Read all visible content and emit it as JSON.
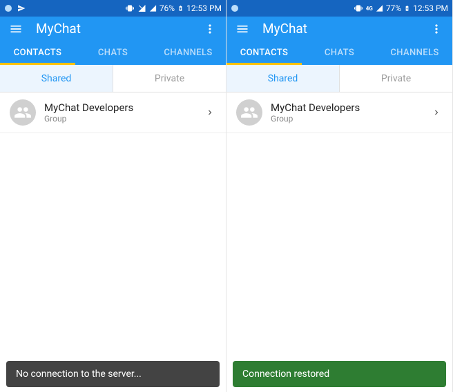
{
  "screens": [
    {
      "statusbar": {
        "battery": "76%",
        "time": "12:53 PM",
        "network": "no-data"
      },
      "appbar": {
        "title": "MyChat"
      },
      "topTabs": [
        {
          "label": "CONTACTS",
          "active": true
        },
        {
          "label": "CHATS",
          "active": false
        },
        {
          "label": "CHANNELS",
          "active": false
        }
      ],
      "subTabs": [
        {
          "label": "Shared",
          "active": true
        },
        {
          "label": "Private",
          "active": false
        }
      ],
      "contacts": [
        {
          "title": "MyChat Developers",
          "subtitle": "Group"
        }
      ],
      "snackbar": {
        "text": "No connection to the server...",
        "style": "dark"
      }
    },
    {
      "statusbar": {
        "battery": "77%",
        "time": "12:53 PM",
        "network": "4g"
      },
      "appbar": {
        "title": "MyChat"
      },
      "topTabs": [
        {
          "label": "CONTACTS",
          "active": true
        },
        {
          "label": "CHATS",
          "active": false
        },
        {
          "label": "CHANNELS",
          "active": false
        }
      ],
      "subTabs": [
        {
          "label": "Shared",
          "active": true
        },
        {
          "label": "Private",
          "active": false
        }
      ],
      "contacts": [
        {
          "title": "MyChat Developers",
          "subtitle": "Group"
        }
      ],
      "snackbar": {
        "text": "Connection restored",
        "style": "green"
      }
    }
  ]
}
